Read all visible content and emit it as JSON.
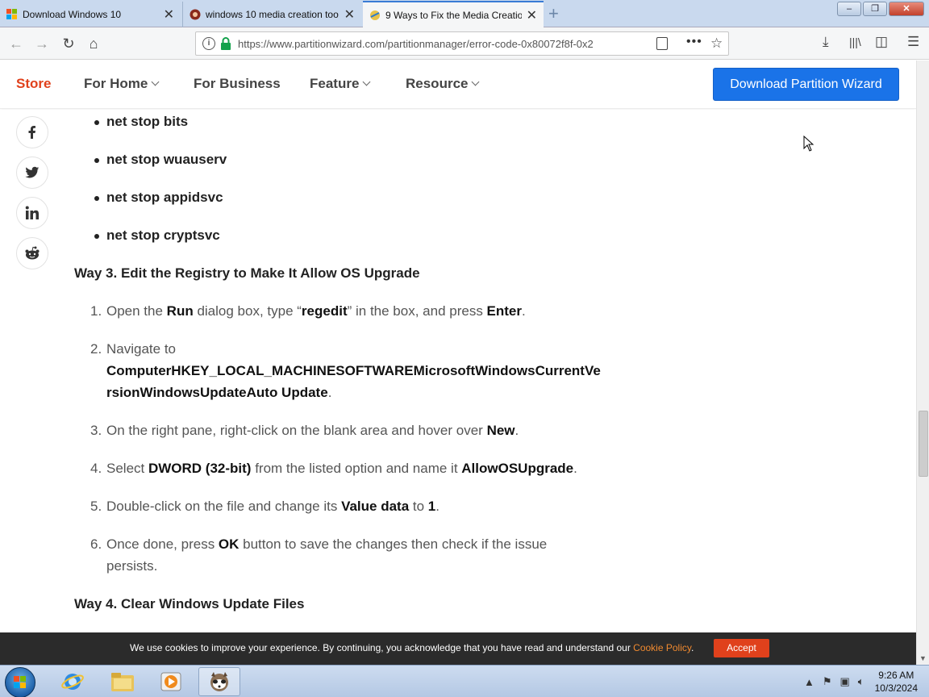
{
  "browser": {
    "tabs": [
      {
        "title": "Download Windows 10",
        "icon": "windows-logo-icon"
      },
      {
        "title": "windows 10 media creation too",
        "icon": "brave-lion-icon"
      },
      {
        "title": "9 Ways to Fix the Media Creatio",
        "icon": "partitionwizard-icon"
      }
    ],
    "url": "https://www.partitionwizard.com/partitionmanager/error-code-0x80072f8f-0x2"
  },
  "site": {
    "nav": {
      "store": "Store",
      "for_home": "For Home",
      "for_business": "For Business",
      "feature": "Feature",
      "resource": "Resource"
    },
    "download_button": "Download Partition Wizard",
    "accent_color": "#e0411c",
    "button_color": "#1a73e8"
  },
  "article": {
    "commands": [
      "net stop bits",
      "net stop wuauserv",
      "net stop appidsvc",
      "net stop cryptsvc"
    ],
    "way3_heading": "Way 3. Edit the Registry to Make It Allow OS Upgrade",
    "steps": {
      "s1": {
        "num": "1.",
        "a": "Open the ",
        "b1": "Run",
        "c": " dialog box, type “",
        "b2": "regedit",
        "d": "” in the box, and press ",
        "b3": "Enter",
        "e": "."
      },
      "s2": {
        "num": "2.",
        "a": "Navigate to",
        "path1": "ComputerHKEY_LOCAL_MACHINESOFTWAREMicrosoftWindowsCurrentVe",
        "path2": "rsionWindowsUpdateAuto Update",
        "e": "."
      },
      "s3": {
        "num": "3.",
        "a": "On the right pane, right-click on the blank area and hover over ",
        "b1": "New",
        "e": "."
      },
      "s4": {
        "num": "4.",
        "a": "Select ",
        "b1": "DWORD (32-bit)",
        "c": " from the listed option and name it ",
        "b2": "AllowOSUpgrade",
        "e": "."
      },
      "s5": {
        "num": "5.",
        "a": "Double-click on the file and change its ",
        "b1": "Value data",
        "c": " to ",
        "b2": "1",
        "e": "."
      },
      "s6": {
        "num": "6.",
        "a": "Once done, press ",
        "b1": "OK",
        "c": " button to save the changes then check if the issue",
        "d": "persists."
      }
    },
    "way4_heading": "Way 4. Clear Windows Update Files"
  },
  "cookie": {
    "text": "We use cookies to improve your experience. By continuing, you acknowledge that you have read and understand our ",
    "link": "Cookie Policy",
    "after": ".",
    "accept": "Accept"
  },
  "taskbar": {
    "time": "9:26 AM",
    "date": "10/3/2024"
  }
}
